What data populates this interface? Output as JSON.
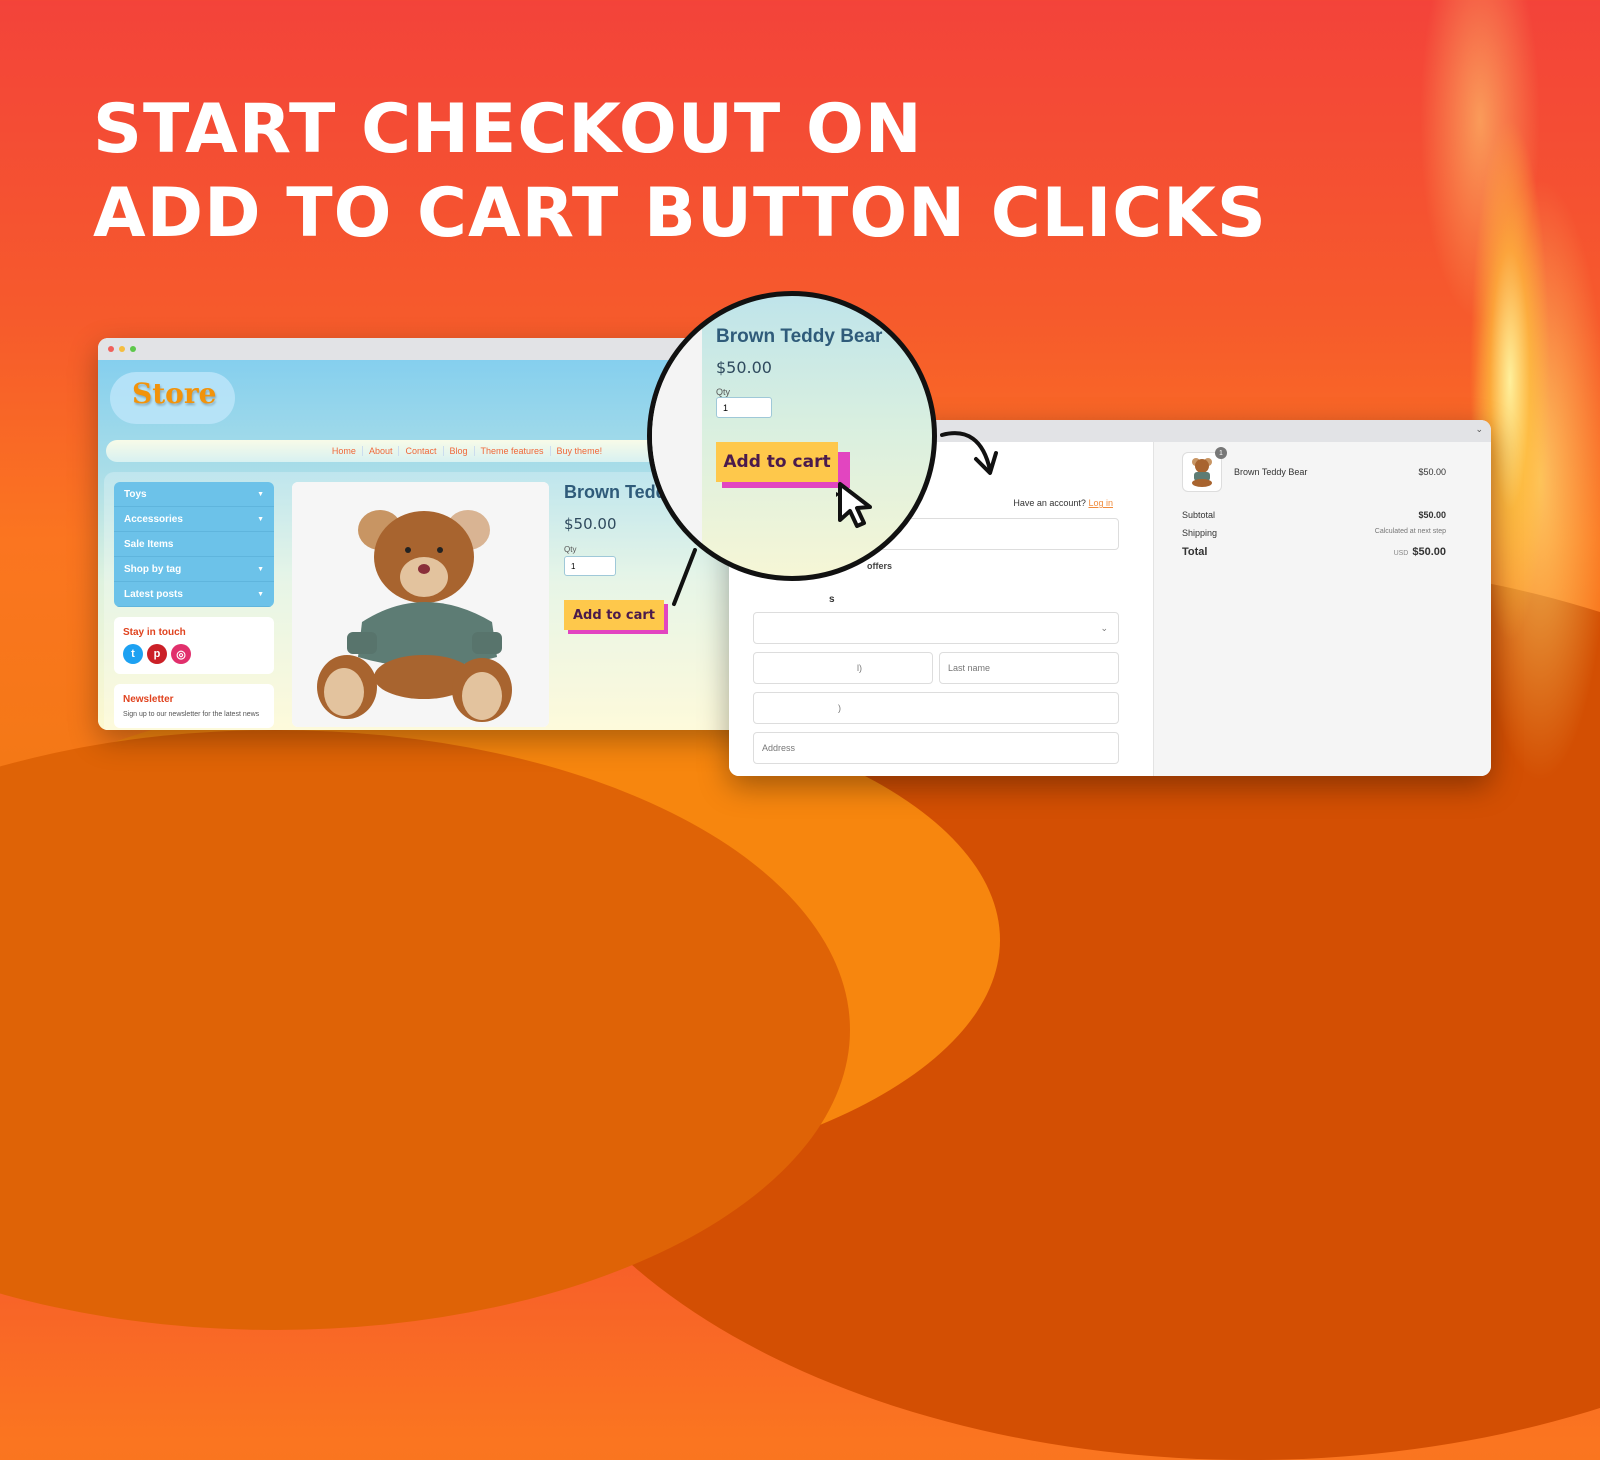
{
  "headline": {
    "line1": "START CHECKOUT ON",
    "line2": "ADD TO CART BUTTON CLICKS"
  },
  "colors": {
    "accent_orange": "#f65a2c",
    "button_yellow": "#fec84b",
    "button_shadow_pink": "#e245c0",
    "button_text": "#4a1a4c",
    "link_orange": "#f08a3b"
  },
  "store": {
    "logo": "Store",
    "nav": [
      "Home",
      "About",
      "Contact",
      "Blog",
      "Theme features",
      "Buy theme!"
    ],
    "sidebar": {
      "items": [
        {
          "label": "Toys",
          "has_dropdown": true
        },
        {
          "label": "Accessories",
          "has_dropdown": true
        },
        {
          "label": "Sale Items",
          "has_dropdown": false
        },
        {
          "label": "Shop by tag",
          "has_dropdown": true
        },
        {
          "label": "Latest posts",
          "has_dropdown": true
        }
      ],
      "stay_in_touch": "Stay in touch",
      "social": [
        "twitter-icon",
        "pinterest-icon",
        "instagram-icon"
      ],
      "newsletter_title": "Newsletter",
      "newsletter_text": "Sign up to our newsletter for the latest news"
    },
    "product": {
      "title": "Brown Teddy Bear",
      "title_visible": "Brown Teddy",
      "price": "$50.00",
      "qty_label": "Qty",
      "qty_value": "1",
      "add_to_cart": "Add to cart"
    }
  },
  "magnifier": {
    "title": "Brown Teddy Bear",
    "price": "$50.00",
    "qty_label": "Qty",
    "qty_value": "1",
    "add_to_cart": "Add to cart"
  },
  "checkout": {
    "have_account": "Have an account?",
    "login": "Log in",
    "offers_partial": "offers",
    "section_partial": "s",
    "first_name_partial": "l)",
    "last_name_placeholder": "Last name",
    "field_partial": ")",
    "address_placeholder": "Address",
    "summary": {
      "item_name": "Brown Teddy Bear",
      "item_qty": "1",
      "item_price": "$50.00",
      "subtotal_label": "Subtotal",
      "subtotal": "$50.00",
      "shipping_label": "Shipping",
      "shipping": "Calculated at next step",
      "total_label": "Total",
      "currency": "USD",
      "total": "$50.00"
    }
  }
}
